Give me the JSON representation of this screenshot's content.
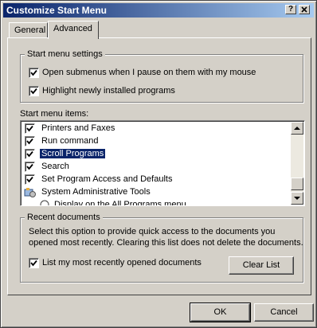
{
  "window": {
    "title": "Customize Start Menu",
    "help_label": "?",
    "close_label": "X"
  },
  "tabs": [
    {
      "label": "General"
    },
    {
      "label": "Advanced"
    }
  ],
  "settings": {
    "group_label": "Start menu settings",
    "items": [
      {
        "label": "Open submenus when I pause on them with my mouse",
        "checked": true
      },
      {
        "label": "Highlight newly installed programs",
        "checked": true
      }
    ]
  },
  "items_label": "Start menu items:",
  "items": [
    {
      "label": "Printers and Faxes",
      "checked": true
    },
    {
      "label": "Run command",
      "checked": true
    },
    {
      "label": "Scroll Programs",
      "checked": true,
      "selected": true
    },
    {
      "label": "Search",
      "checked": true
    },
    {
      "label": "Set Program Access and Defaults",
      "checked": true
    },
    {
      "label": "System Administrative Tools",
      "icon": "admin-tools-icon"
    },
    {
      "label": "Display on the All Programs menu",
      "icon": "radio-icon"
    }
  ],
  "recent": {
    "group_label": "Recent documents",
    "description_line1": "Select this option to provide quick access to the documents you",
    "description_line2": "opened most recently.  Clearing this list does not delete the documents.",
    "checkbox_label": "List my most recently opened documents",
    "checked": true,
    "clear_button": "Clear List"
  },
  "footer": {
    "ok": "OK",
    "cancel": "Cancel"
  }
}
